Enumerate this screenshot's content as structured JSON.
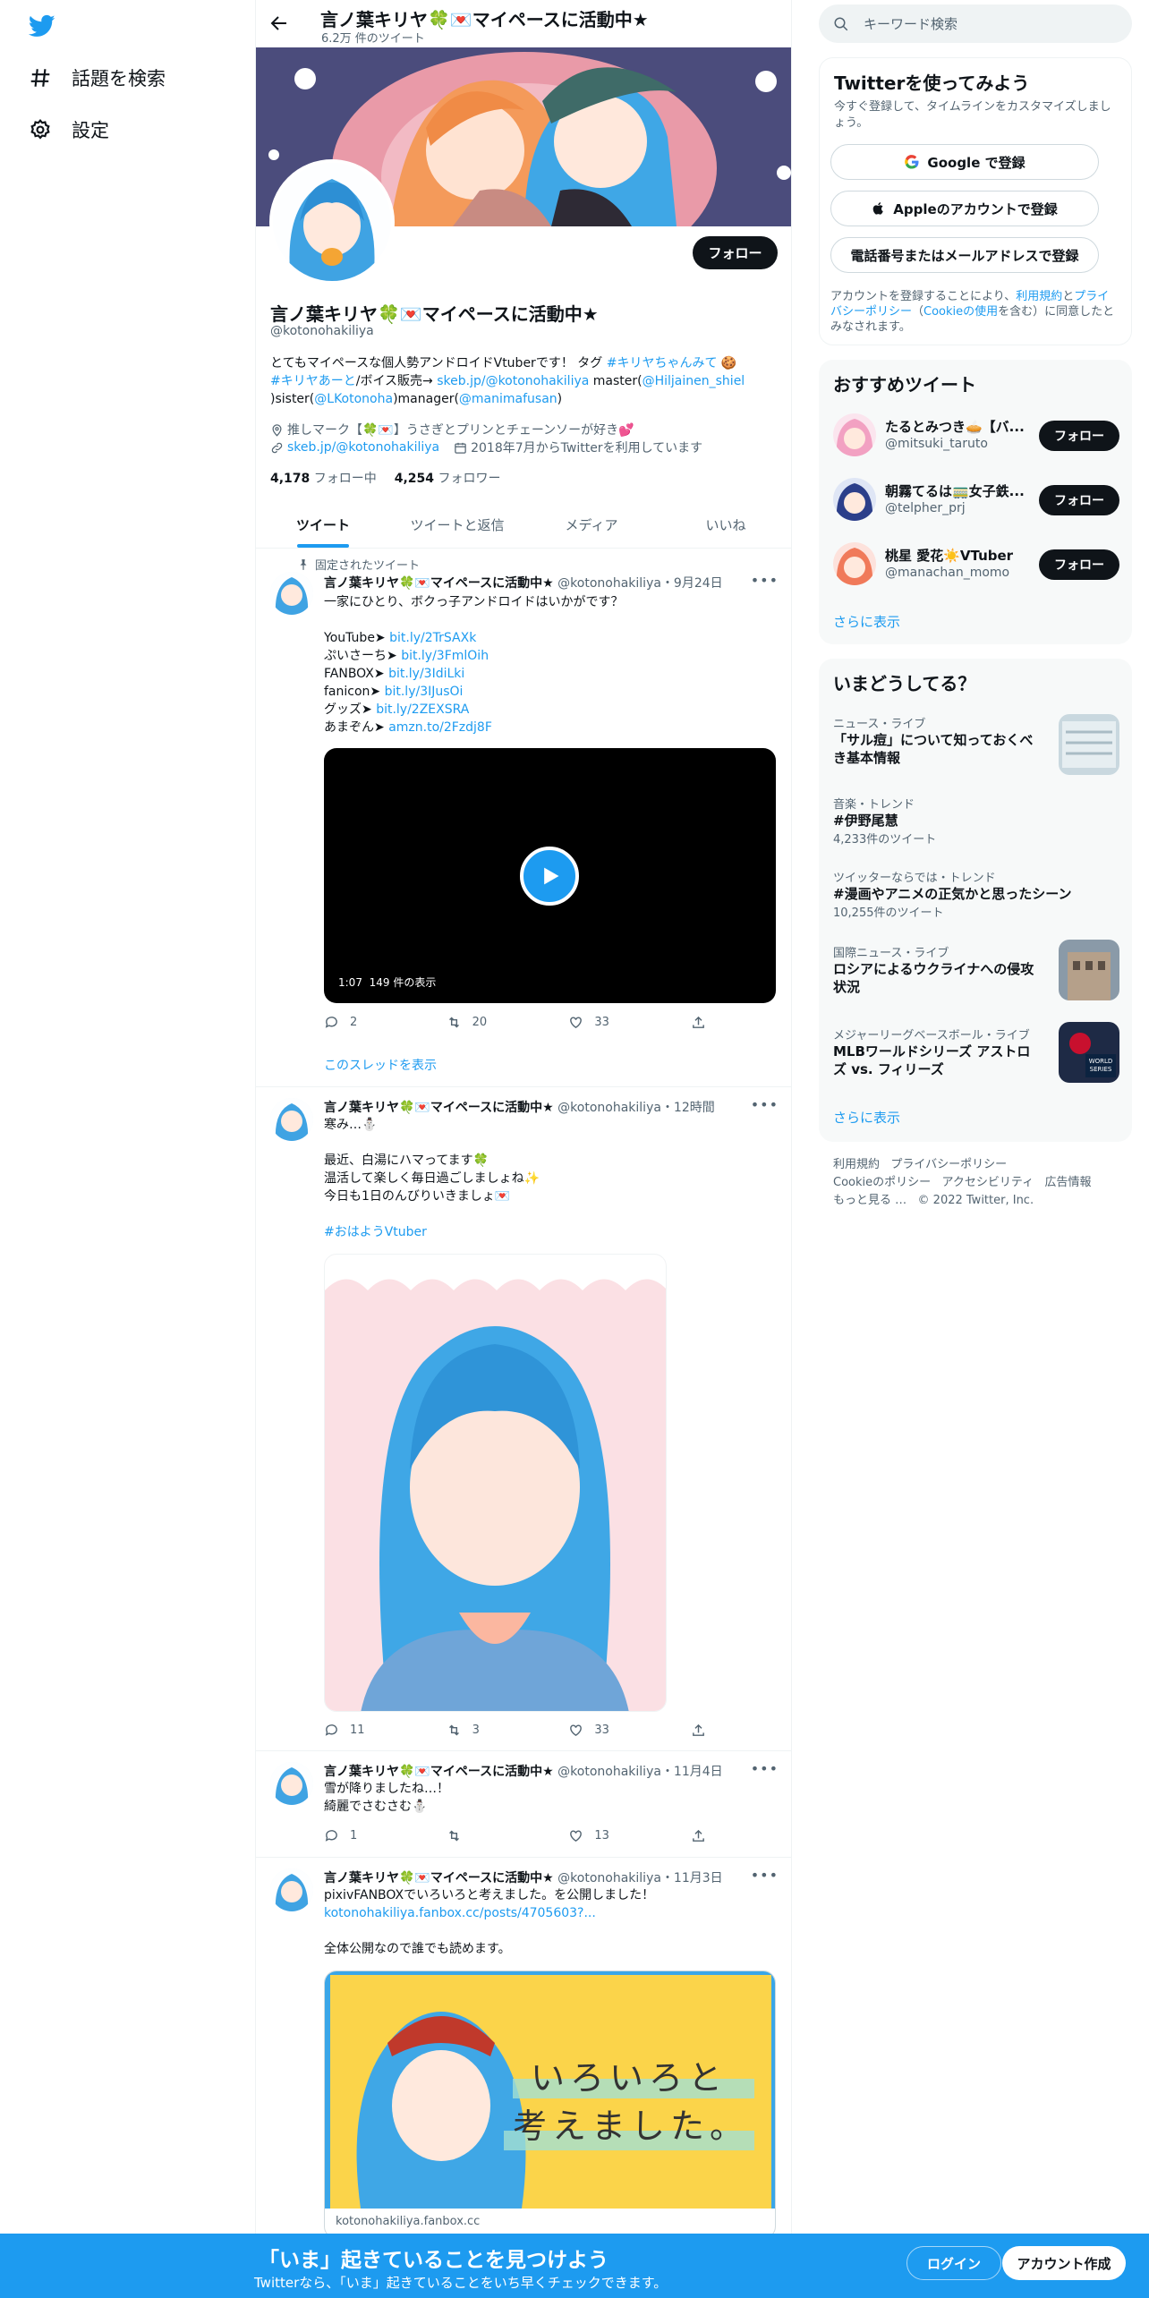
{
  "colors": {
    "accent": "#1d9bf0",
    "text": "#0f1419",
    "muted": "#536471"
  },
  "nav": {
    "items": [
      {
        "label": "話題を検索",
        "icon": "hashtag-icon"
      },
      {
        "label": "設定",
        "icon": "gear-icon"
      }
    ]
  },
  "header": {
    "name": "言ノ葉キリヤ🍀💌マイペースに活動中★",
    "tweet_count": "6.2万 件のツイート"
  },
  "profile": {
    "follow_label": "フォロー",
    "name": "言ノ葉キリヤ🍀💌マイペースに活動中★",
    "handle": "@kotonohakiliya",
    "bio_line1_a": "とてもマイペースな個人勢アンドロイドVtuberです！ タグ ",
    "bio_tag1": "#キリヤちゃんみて",
    "bio_line1_b": " 🍪",
    "bio_tag2": "#キリヤあーと",
    "bio_line2_a": "/ボイス販売→ ",
    "bio_link": "skeb.jp/@kotonohakiliya",
    "bio_line2_b": " master(",
    "bio_master": "@Hiljainen_shiel",
    "bio_line3_a": ")sister(",
    "bio_sister": "@LKotonoha",
    "bio_line3_b": ")manager(",
    "bio_manager": "@manimafusan",
    "bio_line3_c": ")",
    "location": "推しマーク【🍀💌】うさぎとプリンとチェーンソーが好き💕",
    "url": "skeb.jp/@kotonohakiliya",
    "joined": "2018年7月からTwitterを利用しています",
    "following_count": "4,178",
    "following_label": "フォロー中",
    "followers_count": "4,254",
    "followers_label": "フォロワー"
  },
  "tabs": [
    {
      "label": "ツイート"
    },
    {
      "label": "ツイートと返信"
    },
    {
      "label": "メディア"
    },
    {
      "label": "いいね"
    }
  ],
  "tweets": [
    {
      "pinned_label": "固定されたツイート",
      "name": "言ノ葉キリヤ🍀💌マイペースに活動中★",
      "handle": "@kotonohakiliya",
      "date": "・9月24日",
      "text": "一家にひとり、ボクっ子アンドロイドはいかがです？",
      "links": [
        {
          "label": "YouTube➤ ",
          "url": "bit.ly/2TrSAXk"
        },
        {
          "label": "ぷいさーち➤ ",
          "url": "bit.ly/3FmlOih"
        },
        {
          "label": "FANBOX➤ ",
          "url": "bit.ly/3IdiLki"
        },
        {
          "label": "fanicon➤ ",
          "url": "bit.ly/3IJusOi"
        },
        {
          "label": "グッズ➤ ",
          "url": "bit.ly/2ZEXSRA"
        },
        {
          "label": "あまぞん➤ ",
          "url": "amzn.to/2Fzdj8F"
        }
      ],
      "video_duration": "1:07",
      "video_views": "149 件の表示",
      "replies": "2",
      "retweets": "20",
      "likes": "33",
      "thread_label": "このスレッドを表示"
    },
    {
      "name": "言ノ葉キリヤ🍀💌マイペースに活動中★",
      "handle": "@kotonohakiliya",
      "date": "・12時間",
      "line1": "寒み…⛄",
      "line2": "最近、白湯にハマってます🍀",
      "line3": "温活して楽しく毎日過ごしましょね✨",
      "line4": "今日も1日のんびりいきましょ💌",
      "hashtag": "#おはようVtuber",
      "replies": "11",
      "retweets": "3",
      "likes": "33"
    },
    {
      "name": "言ノ葉キリヤ🍀💌マイペースに活動中★",
      "handle": "@kotonohakiliya",
      "date": "・11月4日",
      "line1": "雪が降りましたね…！",
      "line2": "綺麗でさむさむ⛄",
      "replies": "1",
      "retweets": "",
      "likes": "13"
    },
    {
      "name": "言ノ葉キリヤ🍀💌マイペースに活動中★",
      "handle": "@kotonohakiliya",
      "date": "・11月3日",
      "line1": "pixivFANBOXでいろいろと考えました。を公開しました！",
      "link": "kotonohakiliya.fanbox.cc/posts/4705603?...",
      "line2": "全体公開なので誰でも読めます。",
      "card_text1": "いろいろと",
      "card_text2": "考えました。",
      "card_domain": "kotonohakiliya.fanbox.cc"
    }
  ],
  "right": {
    "search_placeholder": "キーワード検索",
    "signup": {
      "title": "Twitterを使ってみよう",
      "subtitle": "今すぐ登録して、タイムラインをカスタマイズしましょう。",
      "google": "Google で登録",
      "apple": "Appleのアカウントで登録",
      "phone": "電話番号またはメールアドレスで登録",
      "terms_a": "アカウントを登録することにより、",
      "terms_l1": "利用規約",
      "terms_b": "と",
      "terms_l2": "プライバシーポリシー",
      "terms_c": "（",
      "terms_l3": "Cookieの使用",
      "terms_d": "を含む）に同意したとみなされます。"
    },
    "recommend": {
      "title": "おすすめツイート",
      "users": [
        {
          "name": "たるとみつき🥧【バ...",
          "handle": "@mitsuki_taruto",
          "follow": "フォロー"
        },
        {
          "name": "朝霧てるは🚃女子鉄...",
          "handle": "@telpher_prj",
          "follow": "フォロー"
        },
        {
          "name": "桃星 愛花☀️VTuber",
          "handle": "@manachan_momo",
          "follow": "フォロー"
        }
      ],
      "more": "さらに表示"
    },
    "trends": {
      "title": "いまどうしてる？",
      "items": [
        {
          "category": "ニュース・ライブ",
          "title": "「サル痘」について知っておくべき基本情報",
          "count": ""
        },
        {
          "category": "音楽・トレンド",
          "title": "#伊野尾慧",
          "count": "4,233件のツイート"
        },
        {
          "category": "ツイッターならでは・トレンド",
          "title": "#漫画やアニメの正気かと思ったシーン",
          "count": "10,255件のツイート"
        },
        {
          "category": "国際ニュース・ライブ",
          "title": "ロシアによるウクライナへの侵攻状況",
          "count": ""
        },
        {
          "category": "メジャーリーグベースボール・ライブ",
          "title": "MLBワールドシリーズ アストロズ vs. フィリーズ",
          "count": ""
        }
      ],
      "more": "さらに表示",
      "image_text": "WORLD SERIES"
    },
    "footer": {
      "l1": "利用規約",
      "l2": "プライバシーポリシー",
      "l3": "Cookieのポリシー",
      "l4": "アクセシビリティ",
      "l5": "広告情報",
      "l6": "もっと見る …",
      "copy": "© 2022 Twitter, Inc."
    }
  },
  "bottom": {
    "title": "「いま」起きていることを見つけよう",
    "subtitle": "Twitterなら、「いま」起きていることをいち早くチェックできます。",
    "login": "ログイン",
    "signup": "アカウント作成"
  }
}
